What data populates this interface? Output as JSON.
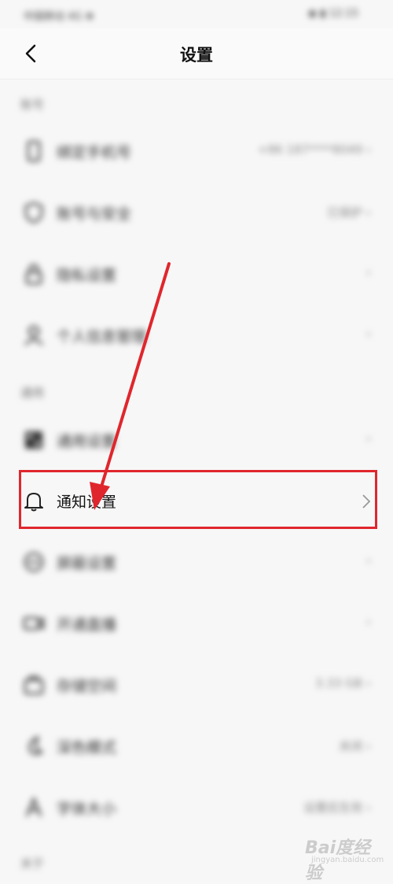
{
  "status_bar": {
    "left_text": "中国移动 4G ❋",
    "right_text": "◉ ▮ 12:15"
  },
  "header": {
    "title": "设置"
  },
  "sections": [
    {
      "label": "账号",
      "items": [
        {
          "label": "绑定手机号",
          "value": "+86 187****8049 ›",
          "icon": "phone-icon"
        },
        {
          "label": "账号与安全",
          "value": "已保护 ›",
          "icon": "shield-icon"
        },
        {
          "label": "隐私设置",
          "value": "›",
          "icon": "lock-icon"
        },
        {
          "label": "个人信息管理",
          "value": "›",
          "icon": "person-icon"
        }
      ]
    },
    {
      "label": "通用",
      "items": [
        {
          "label": "通用设置",
          "value": "›",
          "icon": "grid-icon"
        },
        {
          "label": "通知设置",
          "value": "",
          "icon": "bell-icon"
        },
        {
          "label": "屏蔽设置",
          "value": "›",
          "icon": "block-icon"
        },
        {
          "label": "开通直播",
          "value": "›",
          "icon": "video-icon"
        },
        {
          "label": "存储空间",
          "value": "3.33 GB ›",
          "icon": "storage-icon"
        },
        {
          "label": "深色模式",
          "value": "关闭 ›",
          "icon": "moon-icon"
        },
        {
          "label": "字体大小",
          "value": "设置后生效 ›",
          "icon": "font-size-icon"
        }
      ]
    },
    {
      "label": "关于",
      "items": []
    }
  ],
  "watermark": {
    "logo": "Bai度经验",
    "sub": "jingyan.baidu.com"
  },
  "colors": {
    "highlight": "#e0262d",
    "background": "#f7f7f7"
  }
}
